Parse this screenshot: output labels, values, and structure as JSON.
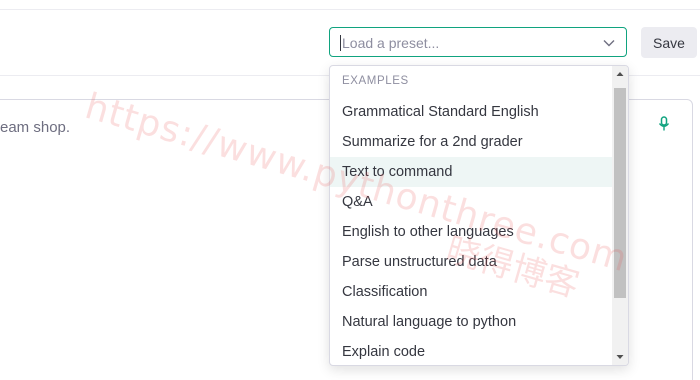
{
  "toolbar": {
    "preset_placeholder": "Load a preset...",
    "save_label": "Save"
  },
  "editor": {
    "visible_text": "eam shop."
  },
  "dropdown": {
    "group_label": "EXAMPLES",
    "options": [
      "Grammatical Standard English",
      "Summarize for a 2nd grader",
      "Text to command",
      "Q&A",
      "English to other languages",
      "Parse unstructured data",
      "Classification",
      "Natural language to python",
      "Explain code"
    ],
    "highlighted_option": "Text to command"
  },
  "watermark": {
    "text": "https://www.pythonthree.com",
    "text_cn": "晓得博客"
  },
  "icons": {
    "select_indicator": "chevron-down-icon",
    "editor_action": "microphone-icon",
    "scroll_up": "arrow-up-icon",
    "scroll_down": "arrow-down-icon"
  },
  "colors": {
    "accent": "#10a37f",
    "highlight": "#eef6f5",
    "watermark": "#eb5050"
  }
}
